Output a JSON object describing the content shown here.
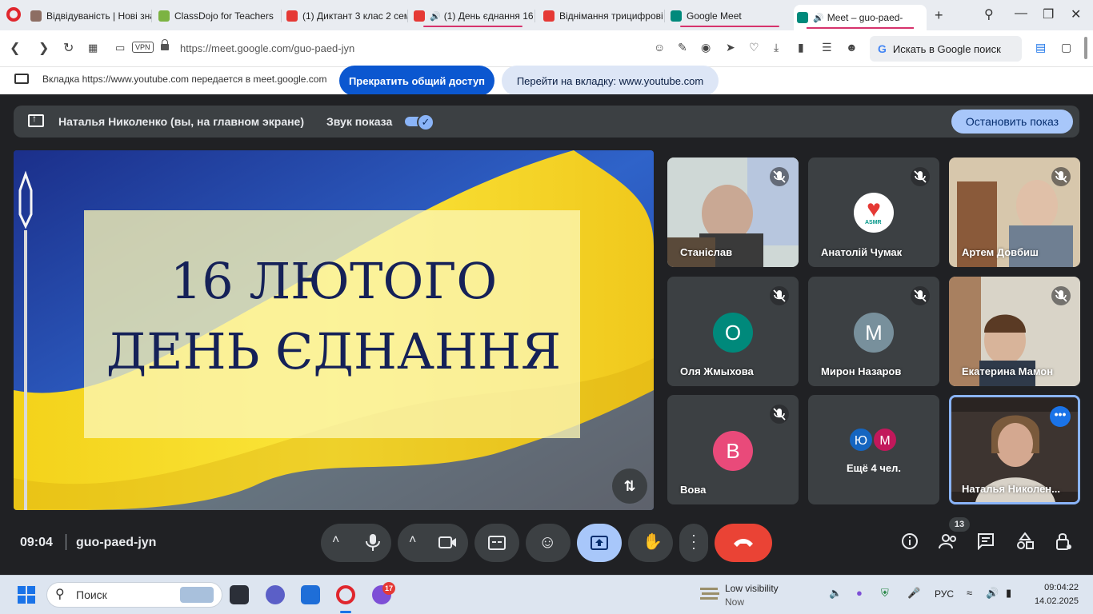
{
  "browser": {
    "tabs": [
      {
        "title": "Відвідуваність | Нові зна",
        "icon_color": "#8d6e63"
      },
      {
        "title": "ClassDojo for Teachers",
        "icon_color": "#7cb342"
      },
      {
        "title": "(1) Диктант 3 клас 2 сем",
        "icon_color": "#e53935"
      },
      {
        "title": "(1) День єднання 16",
        "icon_color": "#e53935"
      },
      {
        "title": "Віднімання трицифрові",
        "icon_color": "#e53935"
      },
      {
        "title": "Google Meet",
        "icon_color": "#00897b"
      },
      {
        "title": "Meet – guo-paed-",
        "icon_color": "#00897b"
      }
    ],
    "new_tab": "+",
    "url": "https://meet.google.com/guo-paed-jyn",
    "vpn": "VPN",
    "search_placeholder": "Искать в Google поиск"
  },
  "share_bar": {
    "message": "Вкладка https://www.youtube.com передается в meet.google.com",
    "stop_button": "Прекратить общий доступ",
    "goto_button": "Перейти на вкладку: www.youtube.com"
  },
  "presentation_bar": {
    "presenter": "Наталья Николенко (вы, на главном экране)",
    "sound_label": "Звук показа",
    "stop_button": "Остановить показ"
  },
  "slide": {
    "line1": "16 ЛЮТОГО",
    "line2": "ДЕНЬ ЄДНАННЯ"
  },
  "participants": [
    {
      "name": "Станіслав",
      "type": "video"
    },
    {
      "name": "Анатолій Чумак",
      "type": "logo"
    },
    {
      "name": "Артем Довбиш",
      "type": "video"
    },
    {
      "name": "Оля Жмыхова",
      "type": "avatar",
      "initial": "О",
      "color": "#00897b"
    },
    {
      "name": "Мирон Назаров",
      "type": "avatar",
      "initial": "М",
      "color": "#78909c"
    },
    {
      "name": "Екатерина Мамон",
      "type": "video"
    },
    {
      "name": "Вова",
      "type": "avatar",
      "initial": "В",
      "color": "#e94a7a"
    },
    {
      "name": "Наталья Николен...",
      "type": "self"
    }
  ],
  "more_tile": {
    "label": "Ещё 4 чел.",
    "initials": [
      "Ю",
      "М"
    ],
    "colors": [
      "#1565c0",
      "#c2185b"
    ]
  },
  "asmr_label": "ASMR",
  "meeting": {
    "time": "09:04",
    "code": "guo-paed-jyn",
    "participants_count": "13"
  },
  "taskbar": {
    "search": "Поиск",
    "viber_badge": "17",
    "weather_title": "Low visibility",
    "weather_sub": "Now",
    "lang": "РУС",
    "time": "09:04:22",
    "date": "14.02.2025"
  }
}
